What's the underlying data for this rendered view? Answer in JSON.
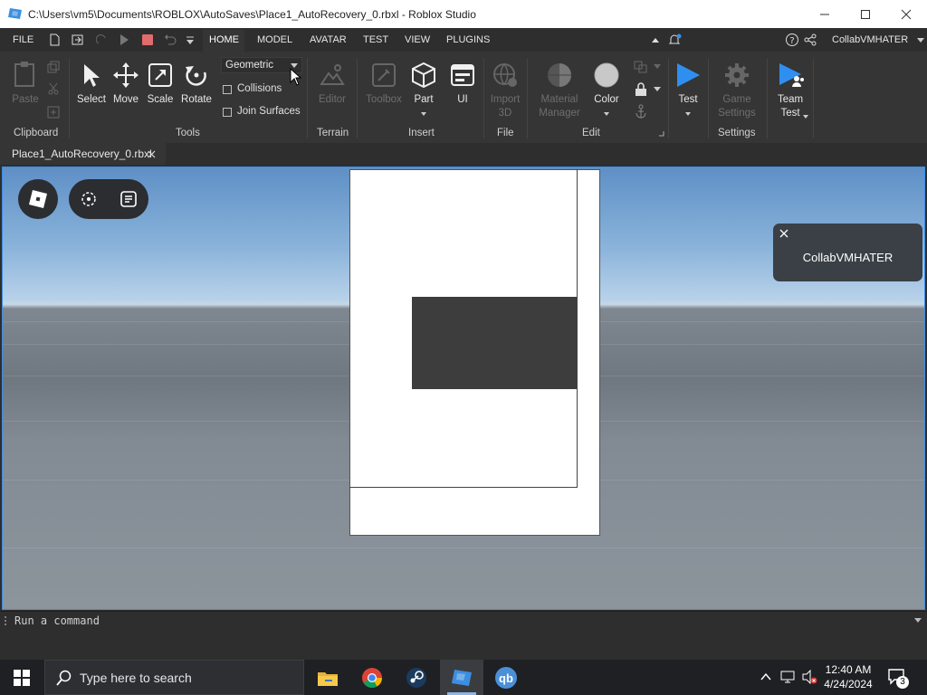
{
  "window": {
    "title": "C:\\Users\\vm5\\Documents\\ROBLOX\\AutoSaves\\Place1_AutoRecovery_0.rbxl - Roblox Studio"
  },
  "menubar": {
    "file": "FILE",
    "tabs": [
      "HOME",
      "MODEL",
      "AVATAR",
      "TEST",
      "VIEW",
      "PLUGINS"
    ],
    "active_tab": "HOME",
    "user": "CollabVMHATER"
  },
  "ribbon": {
    "clipboard": {
      "paste": "Paste",
      "group": "Clipboard"
    },
    "tools": {
      "select": "Select",
      "move": "Move",
      "scale": "Scale",
      "rotate": "Rotate",
      "group": "Tools",
      "mode_dropdown": "Geometric",
      "collisions": "Collisions",
      "join_surfaces": "Join Surfaces"
    },
    "terrain": {
      "editor": "Editor",
      "group": "Terrain"
    },
    "insert": {
      "toolbox": "Toolbox",
      "part": "Part",
      "ui": "UI",
      "group": "Insert"
    },
    "file": {
      "import_line1": "Import",
      "import_line2": "3D",
      "group": "File"
    },
    "edit": {
      "material_line1": "Material",
      "material_line2": "Manager",
      "color": "Color",
      "group": "Edit"
    },
    "test": {
      "test": "Test"
    },
    "settings": {
      "game_line1": "Game",
      "game_line2": "Settings",
      "group": "Settings"
    },
    "team": {
      "line1": "Team",
      "line2": "Test"
    }
  },
  "doc_tab": {
    "label": "Place1_AutoRecovery_0.rbxl"
  },
  "notification": {
    "user": "CollabVMHATER"
  },
  "command_bar": {
    "placeholder": "Run a command"
  },
  "taskbar": {
    "search_placeholder": "Type here to search",
    "time": "12:40 AM",
    "date": "4/24/2024",
    "notification_count": "3"
  },
  "colors": {
    "accent": "#3a8ee6",
    "stop_red": "#e06c6c",
    "play_blue": "#2f8ff0"
  }
}
